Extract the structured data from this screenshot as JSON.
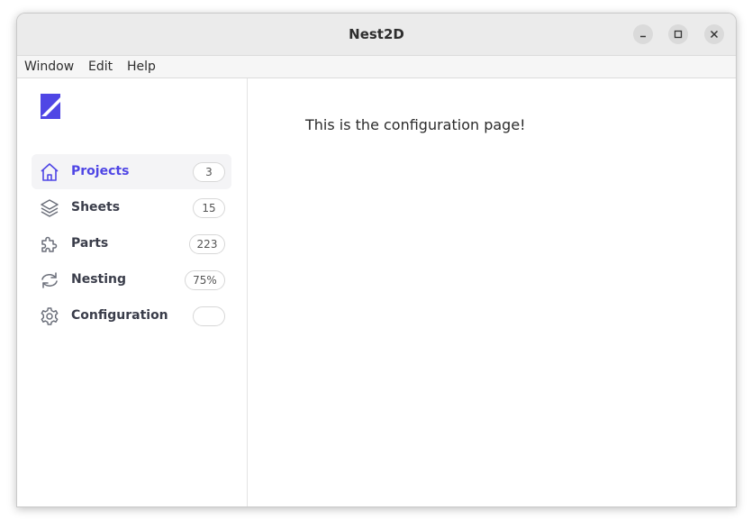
{
  "window": {
    "title": "Nest2D"
  },
  "menubar": {
    "items": [
      "Window",
      "Edit",
      "Help"
    ]
  },
  "sidebar": {
    "accent_color": "#4f46e5",
    "items": [
      {
        "label": "Projects",
        "badge": "3",
        "icon": "home-icon",
        "active": true
      },
      {
        "label": "Sheets",
        "badge": "15",
        "icon": "layers-icon",
        "active": false
      },
      {
        "label": "Parts",
        "badge": "223",
        "icon": "puzzle-icon",
        "active": false
      },
      {
        "label": "Nesting",
        "badge": "75%",
        "icon": "refresh-icon",
        "active": false
      },
      {
        "label": "Configuration",
        "badge": "",
        "icon": "gear-icon",
        "active": false
      }
    ]
  },
  "content": {
    "message": "This is the configuration page!"
  }
}
